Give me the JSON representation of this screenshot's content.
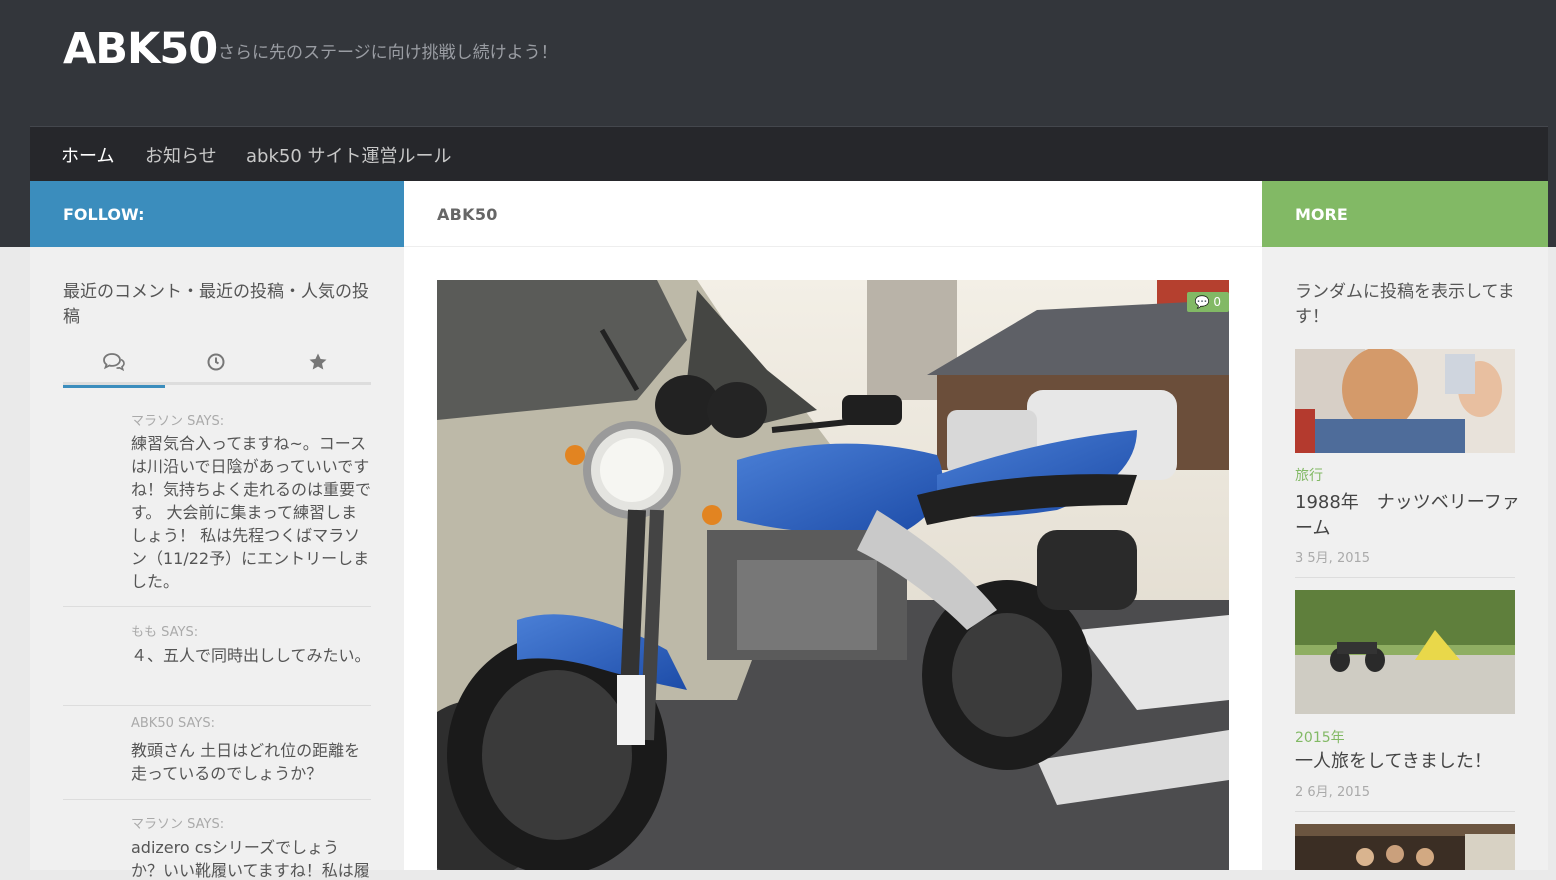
{
  "header": {
    "site_title": "ABK50",
    "tagline": "さらに先のステージに向け挑戦し続けよう！"
  },
  "nav": {
    "items": [
      {
        "label": "ホーム"
      },
      {
        "label": "お知らせ"
      },
      {
        "label": "abk50 サイト運営ルール"
      }
    ]
  },
  "left_sidebar": {
    "heading": "FOLLOW:",
    "widget_title": "最近のコメント・最近の投稿・人気の投稿",
    "tabs": [
      {
        "icon": "comments-icon"
      },
      {
        "icon": "clock-icon"
      },
      {
        "icon": "star-icon"
      }
    ],
    "comments": [
      {
        "author": "マラソン SAYS:",
        "text": "練習気合入ってますね~。コースは川沿いで日陰があっていいですね！気持ちよく走れるのは重要です。 大会前に集まって練習しましょう！ 私は先程つくばマラソン（11/22予）にエントリーしました。"
      },
      {
        "author": "もも SAYS:",
        "text": "４、五人で同時出ししてみたい。"
      },
      {
        "author": "ABK50 SAYS:",
        "text": "教頭さん 土日はどれ位の距離を走っているのでしょうか？"
      },
      {
        "author": "マラソン SAYS:",
        "text": "adizero csシリーズでしょうか？いい靴履いてますね！私は履い"
      }
    ]
  },
  "main": {
    "heading": "ABK50",
    "featured": {
      "comment_count": "0"
    }
  },
  "right_sidebar": {
    "heading": "MORE",
    "random_title": "ランダムに投稿を表示してます！",
    "posts": [
      {
        "category": "旅行",
        "title": "1988年　ナッツベリーファーム",
        "date": "3 5月, 2015"
      },
      {
        "category": "2015年",
        "title": "一人旅をしてきました！",
        "date": "2 6月, 2015"
      }
    ]
  },
  "colors": {
    "header_bg": "#33363b",
    "nav_bg": "#26272b",
    "follow_blue": "#3b8dbd",
    "more_green": "#82b965"
  }
}
